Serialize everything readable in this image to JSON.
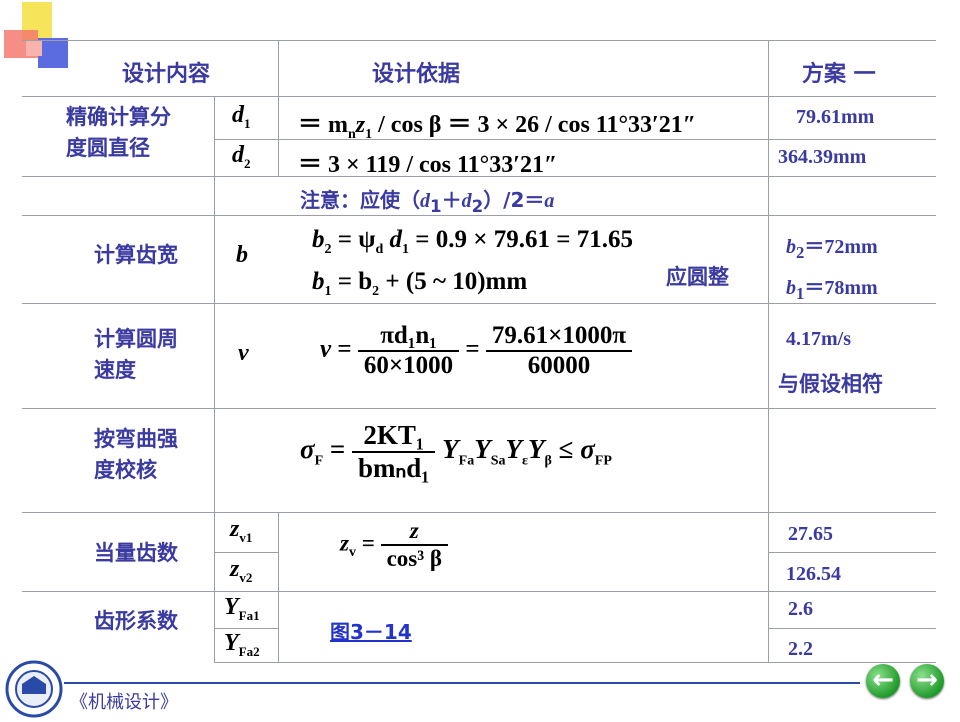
{
  "header": {
    "col1": "设计内容",
    "col2": "设计依据",
    "col3": "方案 一"
  },
  "rows": {
    "diameter": {
      "label_line1": "精确计算分",
      "label_line2": "度圆直径",
      "sym1": "d",
      "sym1_sub": "1",
      "sym2": "d",
      "sym2_sub": "2",
      "eq1": "＝ m",
      "eq1_b": "z",
      "eq1_c": " / cos β ＝ 3 × 26 / cos 11°33′21″",
      "eq2": "＝ 3 × 119 / cos 11°33′21″",
      "res1": "79.61mm",
      "res2": "364.39mm"
    },
    "note": {
      "text_a": "注意：应使（",
      "d1": "d",
      "d1_sub": "1",
      "plus": "＋",
      "d2": "d",
      "d2_sub": "2",
      "text_b": "）/2＝",
      "a": "a"
    },
    "width": {
      "label": "计算齿宽",
      "sym": "b",
      "eq1": "= ψ",
      "eq1_sub": "d",
      "eq1_c": " d",
      "eq1_d": " = 0.9 × 79.61 = 71.65",
      "eq2": "= b",
      "eq2_c": " + (5 ~ 10)mm",
      "round_note": "应圆整",
      "res1": "＝72mm",
      "res2": "＝78mm"
    },
    "speed": {
      "label_line1": "计算圆周",
      "label_line2": "速度",
      "sym": "v",
      "num1": "πd₁n₁",
      "den1": "60×1000",
      "num2": "79.61×1000π",
      "den2": "60000",
      "res1": "4.17m/s",
      "res2": "与假设相符"
    },
    "bending": {
      "label_line1": "按弯曲强",
      "label_line2": "度校核",
      "num": "2KT₁",
      "den": "bmₙd₁"
    },
    "equivalent": {
      "label": "当量齿数",
      "sym1": "z",
      "sym1_sub": "v1",
      "sym2": "z",
      "sym2_sub": "v2",
      "num": "z",
      "den": "cos³ β",
      "res1": "27.65",
      "res2": "126.54"
    },
    "form": {
      "label": "齿形系数",
      "sym1": "Y",
      "sym1_sub": "Fa1",
      "sym2": "Y",
      "sym2_sub": "Fa2",
      "link": "图3－14",
      "res1": "2.6",
      "res2": "2.2"
    }
  },
  "footer": {
    "book": "《机械设计》"
  },
  "colors": {
    "accent": "#3a3aa0",
    "deco_yellow": "#f6e45a",
    "deco_red": "#e8433a",
    "deco_blue": "#4a5bd6"
  },
  "icons": [
    "university-logo-icon",
    "prev-arrow-icon",
    "next-arrow-icon"
  ]
}
